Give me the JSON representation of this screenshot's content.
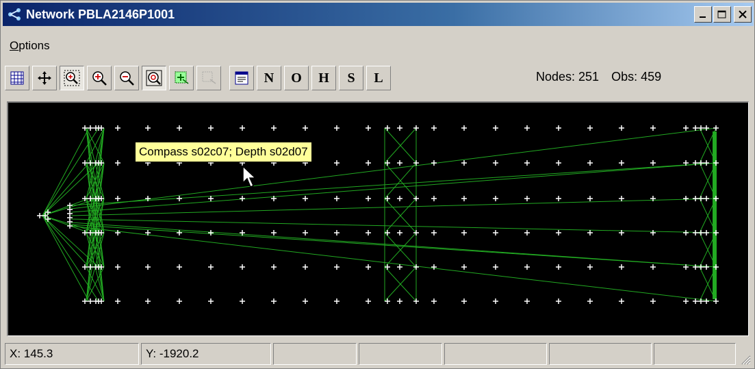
{
  "window": {
    "title": "Network PBLA2146P1001"
  },
  "menu": {
    "options_prefix": "O",
    "options_rest": "ptions"
  },
  "toolbar": {
    "buttons": [
      "grid",
      "pan",
      "zoom-window",
      "zoom-in",
      "zoom-out",
      "zoom-extents",
      "select-node",
      "select-obs",
      "properties"
    ],
    "letters": [
      "N",
      "O",
      "H",
      "S",
      "L"
    ]
  },
  "counts": {
    "nodes": "Nodes: 251",
    "obs": "Obs: 459"
  },
  "tooltip": "Compass s02c07;  Depth s02d07",
  "status": {
    "x": "X: 145.3",
    "y": "Y: -1920.2"
  },
  "colors": {
    "canvas": "#000000",
    "network_lines": "#22aa22",
    "nodes": "#ffffff",
    "tooltip": "#ffff99"
  }
}
